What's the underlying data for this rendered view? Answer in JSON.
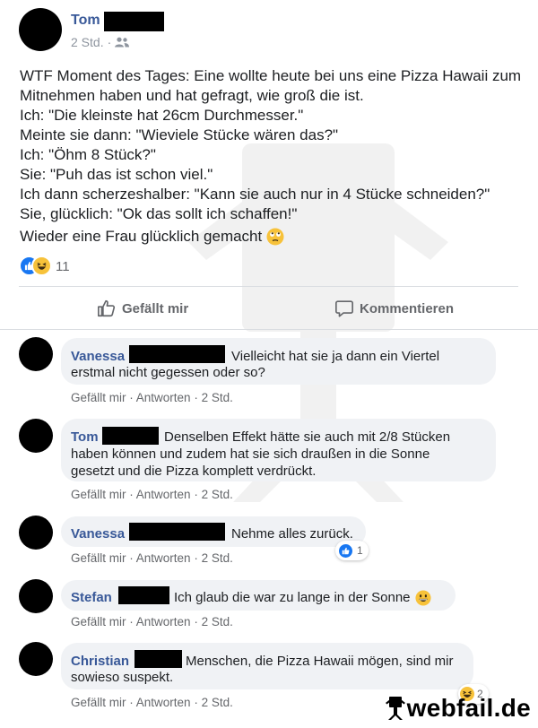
{
  "post": {
    "author": "Tom",
    "time": "2 Std.",
    "audience_icon": "friends-icon",
    "lines": [
      "WTF Moment des Tages: Eine wollte heute bei uns eine Pizza Hawaii zum",
      "Mitnehmen haben und hat gefragt, wie groß die ist.",
      "Ich: \"Die kleinste hat 26cm Durchmesser.\"",
      "Meinte sie dann: \"Wieviele Stücke wären das?\"",
      "Ich: \"Öhm 8 Stück?\"",
      "Sie: \"Puh das ist schon viel.\"",
      "Ich dann scherzeshalber: \"Kann sie auch nur in 4 Stücke schneiden?\"",
      "Sie, glücklich: \"Ok das sollt ich schaffen!\"",
      "Wieder eine Frau glücklich gemacht"
    ],
    "reaction_count": "11",
    "like_label": "Gefällt mir",
    "comment_label": "Kommentieren"
  },
  "comments": [
    {
      "name": "Vanessa",
      "lines": [
        "Vielleicht hat sie ja dann ein Viertel",
        "erstmal nicht gegessen oder so?"
      ]
    },
    {
      "name": "Tom",
      "lines": [
        "Denselben Effekt hätte sie auch mit 2/8 Stücken",
        "haben können und zudem hat sie sich draußen in die Sonne",
        "gesetzt und die Pizza komplett verdrückt."
      ]
    },
    {
      "name": "Vanessa",
      "lines": [
        "Nehme alles zurück."
      ],
      "reaction_count": "1"
    },
    {
      "name": "Stefan",
      "lines": [
        "Ich glaub die war zu lange in der Sonne"
      ]
    },
    {
      "name": "Christian",
      "lines": [
        "Menschen, die Pizza Hawaii mögen, sind mir",
        "sowieso suspekt."
      ],
      "reaction_count": "2"
    }
  ],
  "comment_actions": {
    "like": "Gefällt mir",
    "reply": "Antworten",
    "time": "2 Std."
  },
  "watermark": "webfail.de",
  "colors": {
    "name_blue": "#385898",
    "like_blue": "#1877f2",
    "bubble_gray": "#f0f2f5",
    "meta_gray": "#8d949e"
  }
}
